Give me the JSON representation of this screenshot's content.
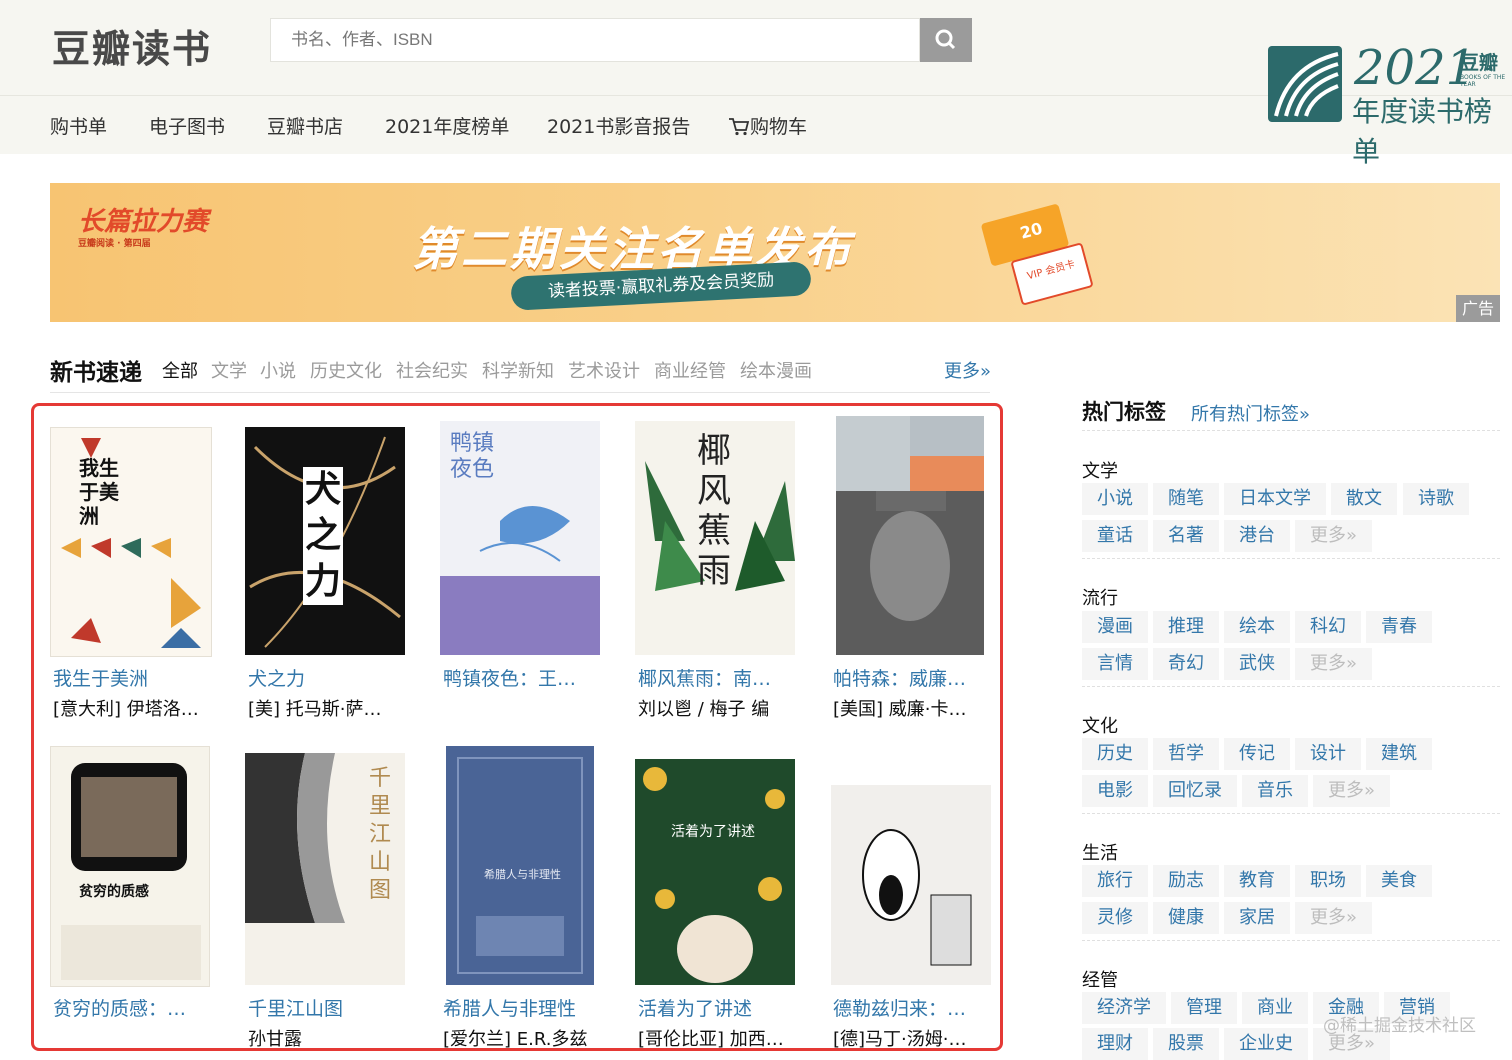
{
  "header": {
    "logo": "豆瓣读书",
    "search_placeholder": "书名、作者、ISBN",
    "nav": [
      "购书单",
      "电子图书",
      "豆瓣书店",
      "2021年度榜单",
      "2021书影音报告",
      "购物车"
    ]
  },
  "badge": {
    "year": "2021",
    "brand": "豆瓣",
    "sub": "BOOKS OF THE YEAR",
    "title": "年度读书榜单"
  },
  "banner": {
    "logo": "长篇拉力赛",
    "logo_sub": "豆瓣阅读 · 第四届",
    "title": "第二期关注名单发布",
    "subtitle": "读者投票·赢取礼券及会员奖励",
    "ticket1": "20",
    "ticket2": "VIP 会员卡",
    "ad_tag": "广告"
  },
  "new_books": {
    "title": "新书速递",
    "categories": [
      "全部",
      "文学",
      "小说",
      "历史文化",
      "社会纪实",
      "科学新知",
      "艺术设计",
      "商业经管",
      "绘本漫画"
    ],
    "more": "更多»",
    "books": [
      {
        "title": "我生于美洲",
        "author": "[意大利] 伊塔洛…",
        "cover_text": "我生于美洲"
      },
      {
        "title": "犬之力",
        "author": "[美] 托马斯·萨…",
        "cover_text": "犬之力"
      },
      {
        "title": "鸭镇夜色：王…",
        "author": "",
        "cover_text": "鸭镇夜色"
      },
      {
        "title": "椰风蕉雨：南…",
        "author": "刘以鬯 / 梅子 编",
        "cover_text": "椰风蕉雨"
      },
      {
        "title": "帕特森：威廉…",
        "author": "[美国] 威廉·卡…",
        "cover_text": ""
      },
      {
        "title": "贫穷的质感：…",
        "author": "",
        "cover_text": "贫穷的质感"
      },
      {
        "title": "千里江山图",
        "author": "孙甘露",
        "cover_text": "千里江山图"
      },
      {
        "title": "希腊人与非理性",
        "author": "[爱尔兰] E.R.多兹",
        "cover_text": "希腊人与非理性"
      },
      {
        "title": "活着为了讲述",
        "author": "[哥伦比亚] 加西…",
        "cover_text": "活着为了讲述"
      },
      {
        "title": "德勒兹归来：…",
        "author": "[德]马丁·汤姆·…",
        "cover_text": ""
      }
    ]
  },
  "hot_tags": {
    "title": "热门标签",
    "all": "所有热门标签»",
    "groups": [
      {
        "name": "文学",
        "tags": [
          "小说",
          "随笔",
          "日本文学",
          "散文",
          "诗歌",
          "童话",
          "名著",
          "港台",
          "更多»"
        ]
      },
      {
        "name": "流行",
        "tags": [
          "漫画",
          "推理",
          "绘本",
          "科幻",
          "青春",
          "言情",
          "奇幻",
          "武侠",
          "更多»"
        ]
      },
      {
        "name": "文化",
        "tags": [
          "历史",
          "哲学",
          "传记",
          "设计",
          "建筑",
          "电影",
          "回忆录",
          "音乐",
          "更多»"
        ]
      },
      {
        "name": "生活",
        "tags": [
          "旅行",
          "励志",
          "教育",
          "职场",
          "美食",
          "灵修",
          "健康",
          "家居",
          "更多»"
        ]
      },
      {
        "name": "经管",
        "tags": [
          "经济学",
          "管理",
          "商业",
          "金融",
          "营销",
          "理财",
          "股票",
          "企业史",
          "更多»"
        ]
      }
    ]
  },
  "watermark": "@稀土掘金技术社区"
}
